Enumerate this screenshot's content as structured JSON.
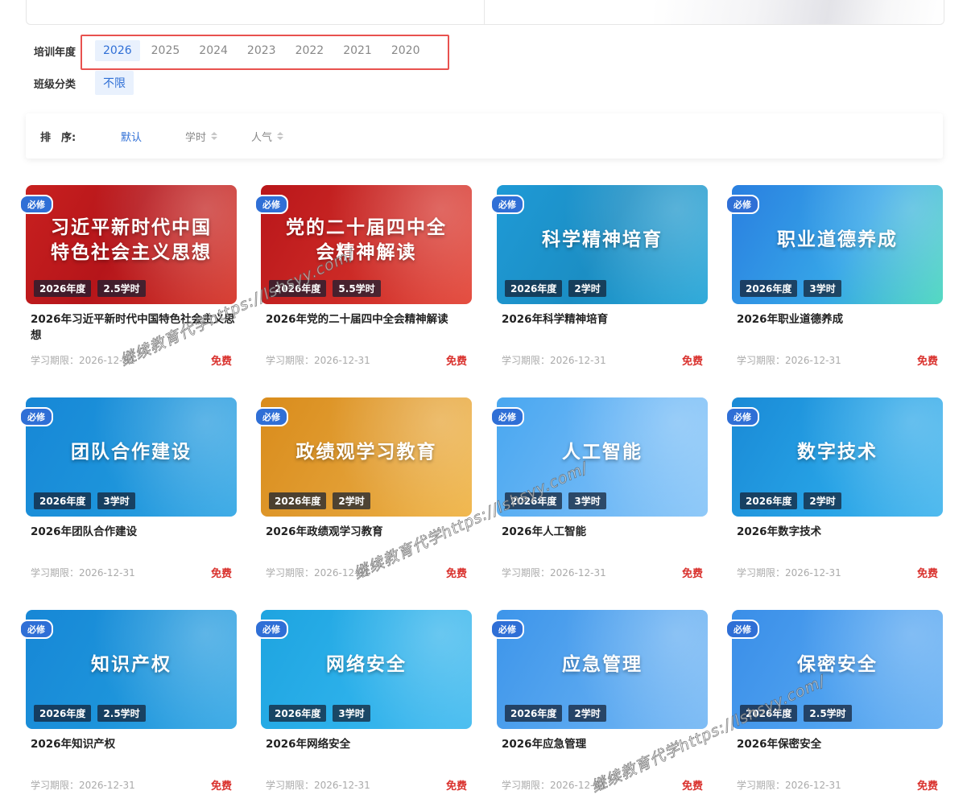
{
  "filters": {
    "year_label": "培训年度",
    "years": [
      "2026",
      "2025",
      "2024",
      "2023",
      "2022",
      "2021",
      "2020"
    ],
    "selected_year": "2026",
    "class_label": "班级分类",
    "class_options": [
      "不限"
    ]
  },
  "sort": {
    "label": "排　序:",
    "options": [
      "默认",
      "学时",
      "人气"
    ],
    "active": "默认"
  },
  "courses": [
    {
      "badge": "必修",
      "cover_title": "习近平新时代中国特色社会主义思想",
      "year_tag": "2026年度",
      "hours_tag": "2.5学时",
      "name": "2026年习近平新时代中国特色社会主义思想",
      "deadline": "学习期限：2026-12-31",
      "price": "免费",
      "theme": "red"
    },
    {
      "badge": "必修",
      "cover_title": "党的二十届四中全会精神解读",
      "year_tag": "2026年度",
      "hours_tag": "5.5学时",
      "name": "2026年党的二十届四中全会精神解读",
      "deadline": "学习期限：2026-12-31",
      "price": "免费",
      "theme": "red2"
    },
    {
      "badge": "必修",
      "cover_title": "科学精神培育",
      "year_tag": "2026年度",
      "hours_tag": "2学时",
      "name": "2026年科学精神培育",
      "deadline": "学习期限：2026-12-31",
      "price": "免费",
      "theme": "teal"
    },
    {
      "badge": "必修",
      "cover_title": "职业道德养成",
      "year_tag": "2026年度",
      "hours_tag": "3学时",
      "name": "2026年职业道德养成",
      "deadline": "学习期限：2026-12-31",
      "price": "免费",
      "theme": "bluegreen"
    },
    {
      "badge": "必修",
      "cover_title": "团队合作建设",
      "year_tag": "2026年度",
      "hours_tag": "3学时",
      "name": "2026年团队合作建设",
      "deadline": "学习期限：2026-12-31",
      "price": "免费",
      "theme": "blue"
    },
    {
      "badge": "必修",
      "cover_title": "政绩观学习教育",
      "year_tag": "2026年度",
      "hours_tag": "2学时",
      "name": "2026年政绩观学习教育",
      "deadline": "学习期限：2026-12-31",
      "price": "免费",
      "theme": "gold"
    },
    {
      "badge": "必修",
      "cover_title": "人工智能",
      "year_tag": "2026年度",
      "hours_tag": "3学时",
      "name": "2026年人工智能",
      "deadline": "学习期限：2026-12-31",
      "price": "免费",
      "theme": "sky"
    },
    {
      "badge": "必修",
      "cover_title": "数字技术",
      "year_tag": "2026年度",
      "hours_tag": "2学时",
      "name": "2026年数字技术",
      "deadline": "学习期限：2026-12-31",
      "price": "免费",
      "theme": "cyan"
    },
    {
      "badge": "必修",
      "cover_title": "知识产权",
      "year_tag": "2026年度",
      "hours_tag": "2.5学时",
      "name": "2026年知识产权",
      "deadline": "学习期限：2026-12-31",
      "price": "免费",
      "theme": "blue"
    },
    {
      "badge": "必修",
      "cover_title": "网络安全",
      "year_tag": "2026年度",
      "hours_tag": "3学时",
      "name": "2026年网络安全",
      "deadline": "学习期限：2026-12-31",
      "price": "免费",
      "theme": "azure"
    },
    {
      "badge": "必修",
      "cover_title": "应急管理",
      "year_tag": "2026年度",
      "hours_tag": "2学时",
      "name": "2026年应急管理",
      "deadline": "学习期限：2026-12-31",
      "price": "免费",
      "theme": "sky2"
    },
    {
      "badge": "必修",
      "cover_title": "保密安全",
      "year_tag": "2026年度",
      "hours_tag": "2.5学时",
      "name": "2026年保密安全",
      "deadline": "学习期限：2026-12-31",
      "price": "免费",
      "theme": "sky3"
    }
  ],
  "watermark_text": "继续教育代学https://lshsyy.com/",
  "colors": {
    "accent": "#2f6fd6",
    "highlight_box": "#e8524f",
    "price": "#d9302c"
  }
}
